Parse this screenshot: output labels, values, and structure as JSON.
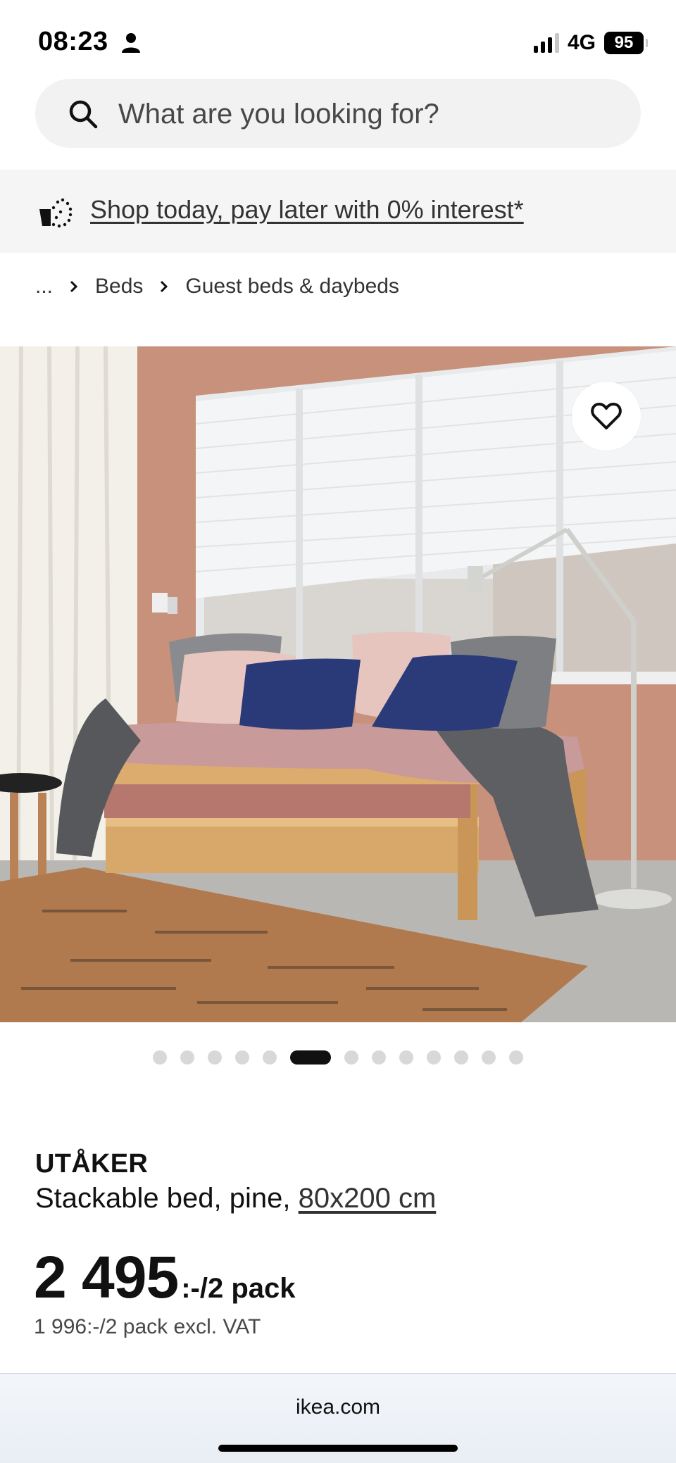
{
  "status_bar": {
    "time": "08:23",
    "network": "4G",
    "battery": "95",
    "signal_bars_filled": 3,
    "signal_bars_total": 4
  },
  "search": {
    "placeholder": "What are you looking for?",
    "icon": "search-icon"
  },
  "promo": {
    "link_text": "Shop today, pay later with 0% interest*",
    "icon": "piggy-bank-icon"
  },
  "breadcrumb": {
    "ellipsis": "...",
    "items": [
      "Beds",
      "Guest beds & daybeds"
    ]
  },
  "gallery": {
    "image_count": 13,
    "active_index": 5,
    "favorite_icon": "heart-icon"
  },
  "product": {
    "name": "UTÅKER",
    "description": "Stackable bed, pine, ",
    "size": "80x200 cm",
    "price": "2 495",
    "price_suffix": ":-/2 pack",
    "price_excl_vat": "1 996:-/2 pack excl. VAT"
  },
  "browser": {
    "url": "ikea.com"
  },
  "colors": {
    "accent": "#111111",
    "search_bg": "#f2f2f2",
    "promo_bg": "#f5f5f5",
    "wall": "#c9937e"
  }
}
